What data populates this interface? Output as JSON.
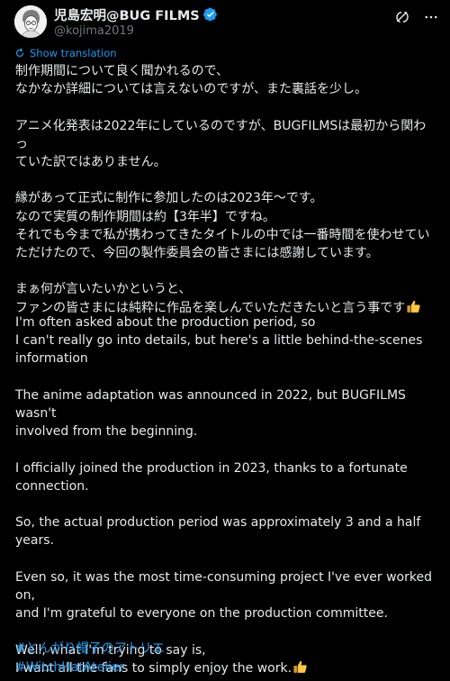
{
  "author": {
    "display_name": "児島宏明@BUG FILMS",
    "handle": "@kojima2019",
    "verified": true
  },
  "translate_label": "Show translation",
  "post_jp": [
    "制作期間について良く聞かれるので、\nなかなか詳細については言えないのですが、また裏話を少し。",
    "アニメ化発表は2022年にしているのですが、BUGFILMSは最初から関わっ\nていた訳ではありません。",
    "縁があって正式に制作に参加したのは2023年〜です。\nなので実質の制作期間は約【3年半】ですね。\nそれでも今まで私が携わってきたタイトルの中では一番時間を使わせてい\nただけたので、今回の製作委員会の皆さまには感謝しています。",
    "まぁ何が言いたいかというと、\nファンの皆さまには純粋に作品を楽しんでいただきたいと言う事です"
  ],
  "post_en": [
    "I'm often asked about the production period, so\nI can't really go into details, but here's a little behind-the-scenes\ninformation",
    "The anime adaptation was announced in 2022, but BUGFILMS wasn't\ninvolved from the beginning.",
    "I officially joined the production in 2023, thanks to a fortunate\nconnection.",
    "So, the actual production period was approximately 3 and a half years.",
    "Even so, it was the most time-consuming project I've ever worked on,\nand I'm grateful to everyone on the production committee.",
    "Well, what I'm trying to say is,\nI want all the fans to simply enjoy the work."
  ],
  "hashtags": [
    "#とんがり帽子のアトリエ",
    "#WitchHatAtelier"
  ],
  "colors": {
    "link": "#1d9bf0",
    "text": "#e7e9ea",
    "muted": "#71767b",
    "background": "#000000"
  }
}
